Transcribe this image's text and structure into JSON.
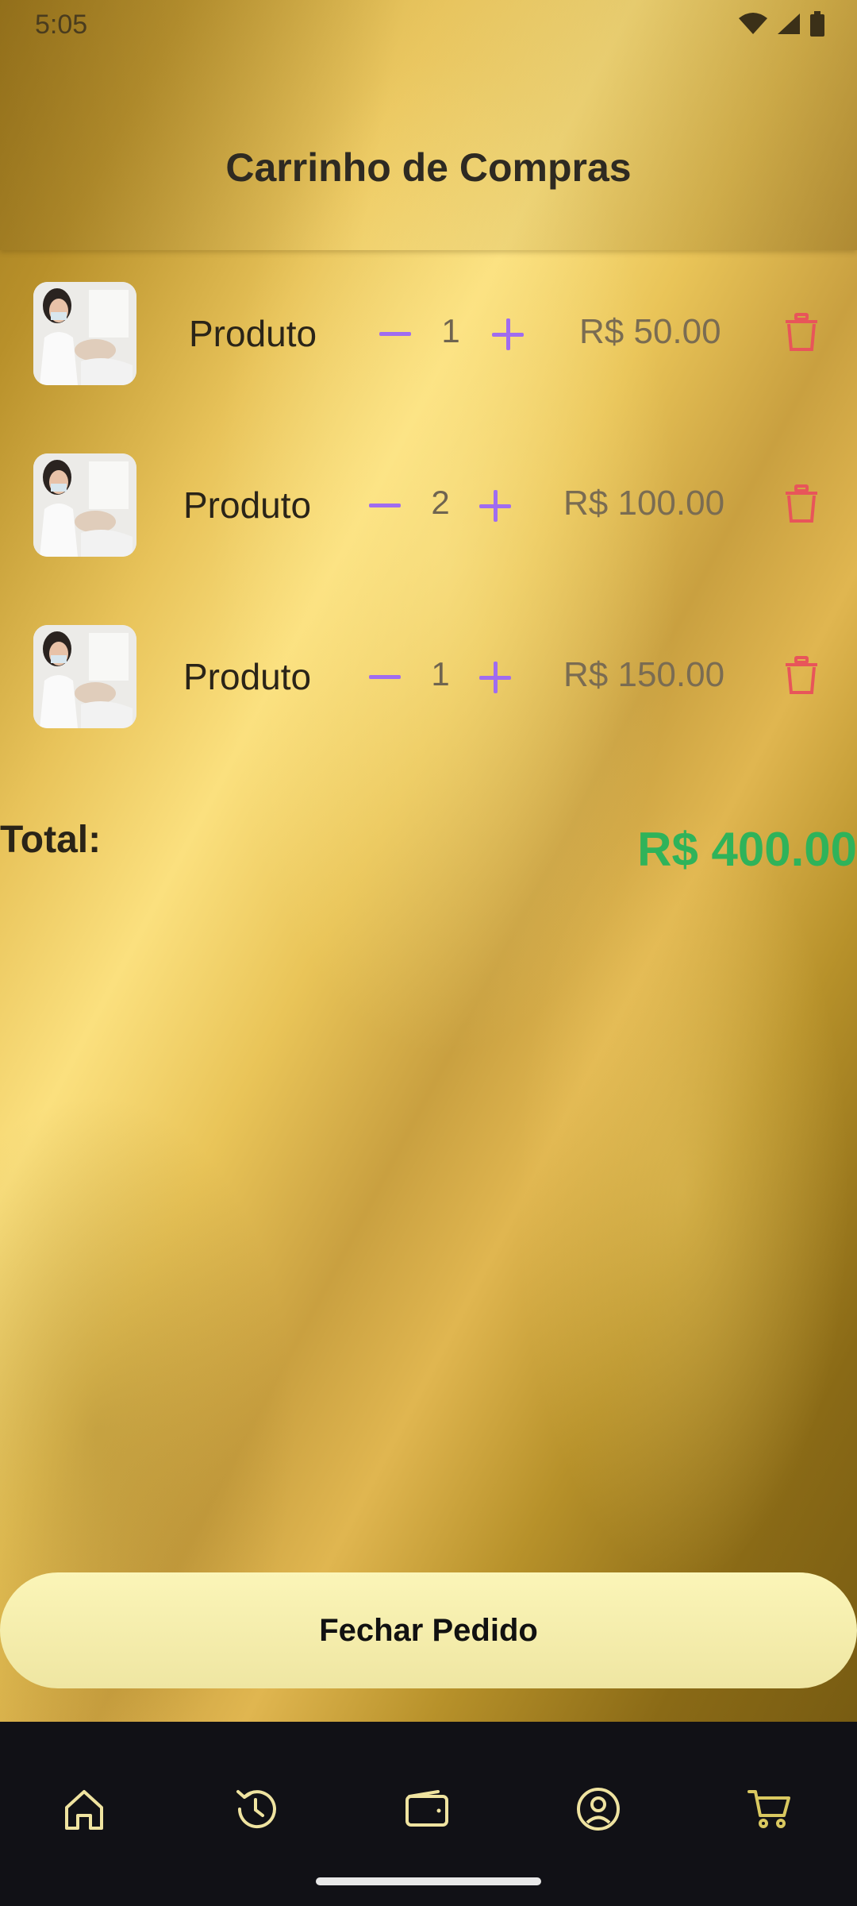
{
  "status_bar": {
    "time": "5:05"
  },
  "header": {
    "title": "Carrinho de Compras"
  },
  "cart": {
    "items": [
      {
        "name": "Produto",
        "quantity": "1",
        "price": "R$ 50.00",
        "image": "product-photo-facial-treatment"
      },
      {
        "name": "Produto",
        "quantity": "2",
        "price": "R$ 100.00",
        "image": "product-photo-facial-treatment"
      },
      {
        "name": "Produto",
        "quantity": "1",
        "price": "R$ 150.00",
        "image": "product-photo-facial-treatment"
      }
    ],
    "total_label": "Total:",
    "total_value": "R$ 400.00"
  },
  "checkout": {
    "label": "Fechar Pedido"
  },
  "bottom_nav": {
    "items": [
      {
        "icon": "home-icon"
      },
      {
        "icon": "history-icon"
      },
      {
        "icon": "wallet-icon"
      },
      {
        "icon": "profile-icon"
      },
      {
        "icon": "cart-icon",
        "active": true
      }
    ]
  },
  "colors": {
    "accent_purple": "#a06cf0",
    "delete_red": "#e8555a",
    "total_green": "#2fb35a",
    "nav_icon": "#efe3a0"
  }
}
